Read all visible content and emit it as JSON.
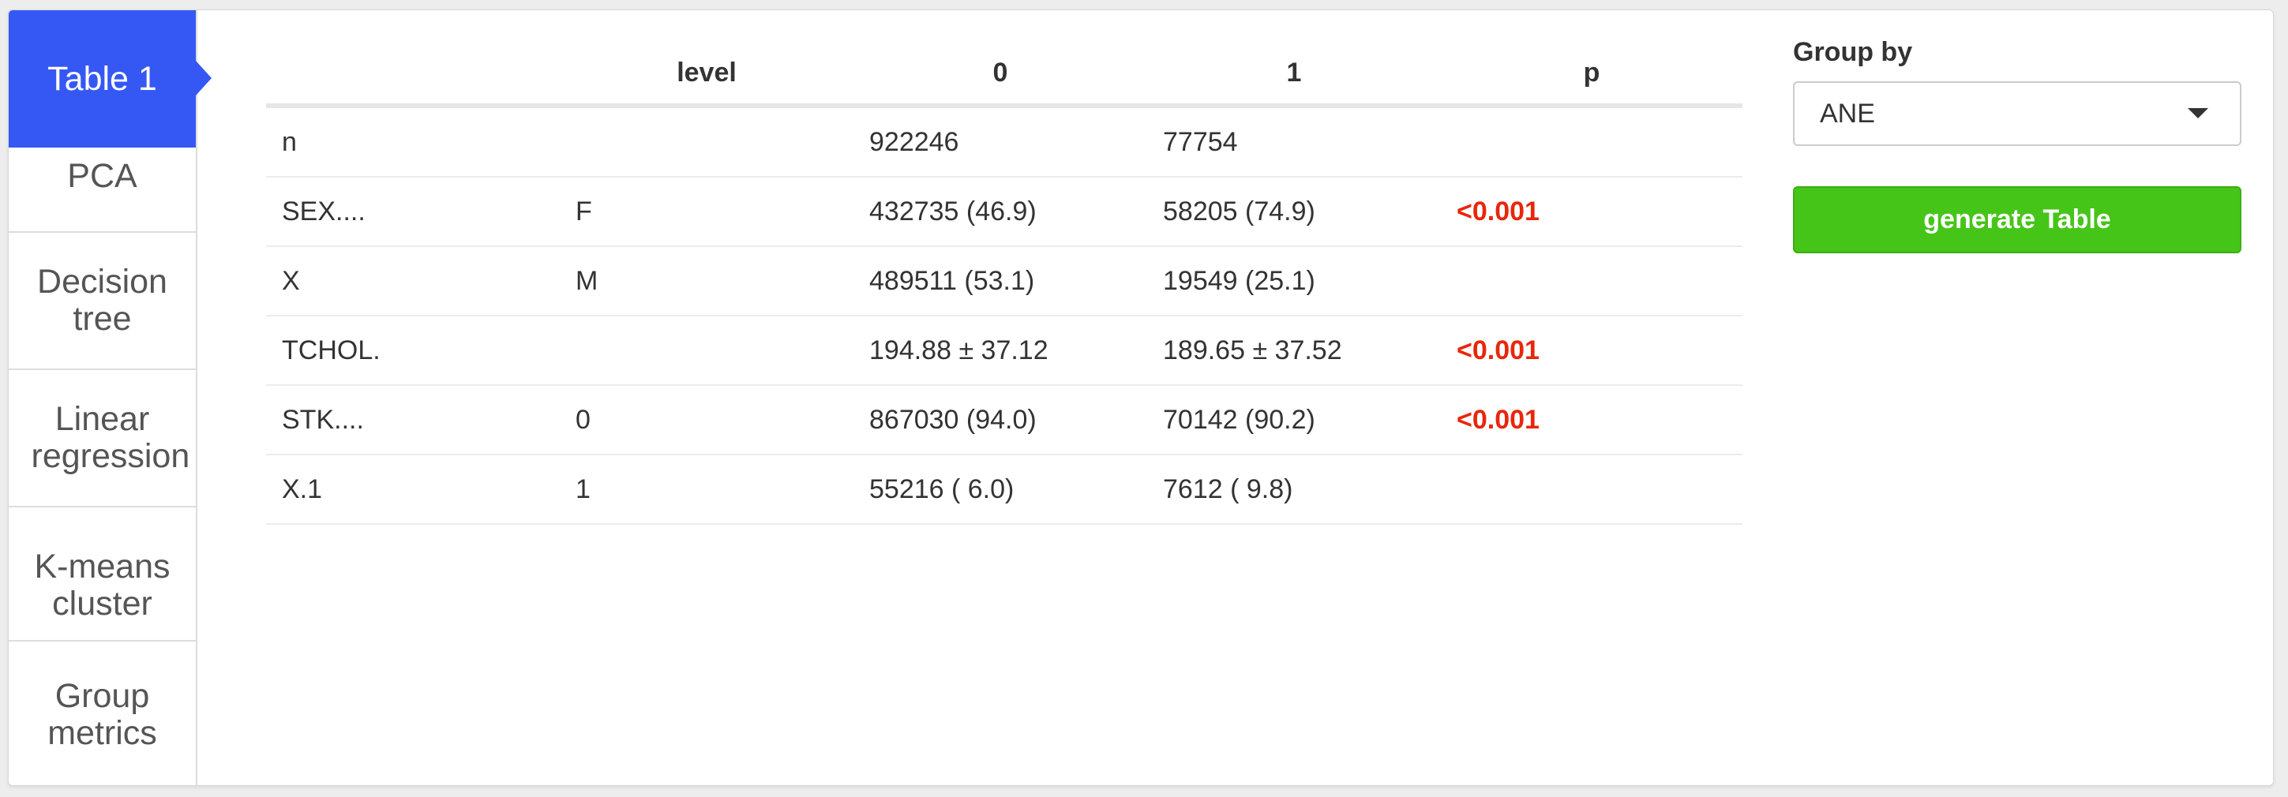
{
  "tabs": [
    {
      "label": "Table 1"
    },
    {
      "label": "PCA"
    },
    {
      "label": "Decision tree"
    },
    {
      "label": "Linear regression"
    },
    {
      "label": "K-means cluster"
    },
    {
      "label": "Group metrics"
    }
  ],
  "table": {
    "headers": [
      "",
      "level",
      "0",
      "1",
      "p"
    ],
    "rows": [
      [
        "n",
        "",
        "922246",
        "77754",
        ""
      ],
      [
        "SEX....",
        "F",
        "432735 (46.9)",
        "58205 (74.9)",
        "<0.001"
      ],
      [
        "X",
        "M",
        "489511 (53.1)",
        "19549 (25.1)",
        ""
      ],
      [
        "TCHOL.",
        "",
        "194.88 ± 37.12",
        "189.65 ± 37.52",
        "<0.001"
      ],
      [
        "STK....",
        "0",
        "867030 (94.0)",
        "70142 (90.2)",
        "<0.001"
      ],
      [
        "X.1",
        "1",
        "55216 ( 6.0)",
        "7612 ( 9.8)",
        ""
      ]
    ]
  },
  "controls": {
    "group_by_label": "Group by",
    "group_by_value": "ANE",
    "generate_label": "generate Table"
  },
  "colors": {
    "active_tab": "#3558f5",
    "button": "#46c519",
    "p_value": "#e8260c"
  }
}
